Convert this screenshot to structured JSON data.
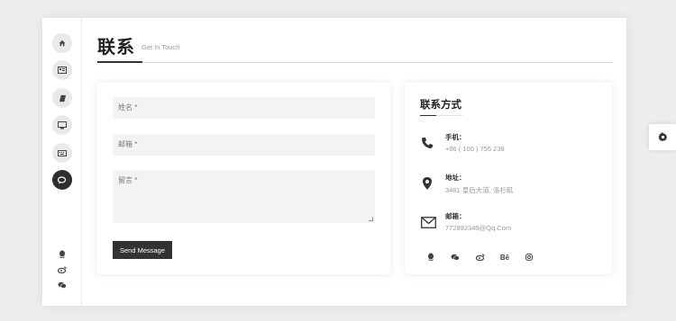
{
  "header": {
    "title": "联系",
    "subtitle": "Get In Touch"
  },
  "sidebar": {
    "nav": [
      {
        "icon": "home-icon",
        "active": false
      },
      {
        "icon": "id-card-icon",
        "active": false
      },
      {
        "icon": "book-icon",
        "active": false
      },
      {
        "icon": "desktop-icon",
        "active": false
      },
      {
        "icon": "keyboard-icon",
        "active": false
      },
      {
        "icon": "chat-icon",
        "active": true
      }
    ],
    "social": [
      "qq-icon",
      "weibo-icon",
      "wechat-icon"
    ]
  },
  "form": {
    "name_placeholder": "姓名 *",
    "email_placeholder": "邮箱 *",
    "message_placeholder": "留言 *",
    "send_label": "Send Message"
  },
  "contact": {
    "title": "联系方式",
    "phone_label": "手机：",
    "phone_value": "+86 ( 100 ) 755 238",
    "address_label": "地址：",
    "address_value": "3481 皇后大道, 洛杉矶",
    "email_label": "邮箱：",
    "email_value": "772892349@Qq.Com",
    "social": [
      "qq-icon",
      "wechat-icon",
      "weibo-icon",
      "behance-icon",
      "instagram-icon"
    ],
    "behance_text": "Bē"
  },
  "colors": {
    "dark": "#333333",
    "field_bg": "#f3f3f3",
    "background": "#ededed"
  }
}
